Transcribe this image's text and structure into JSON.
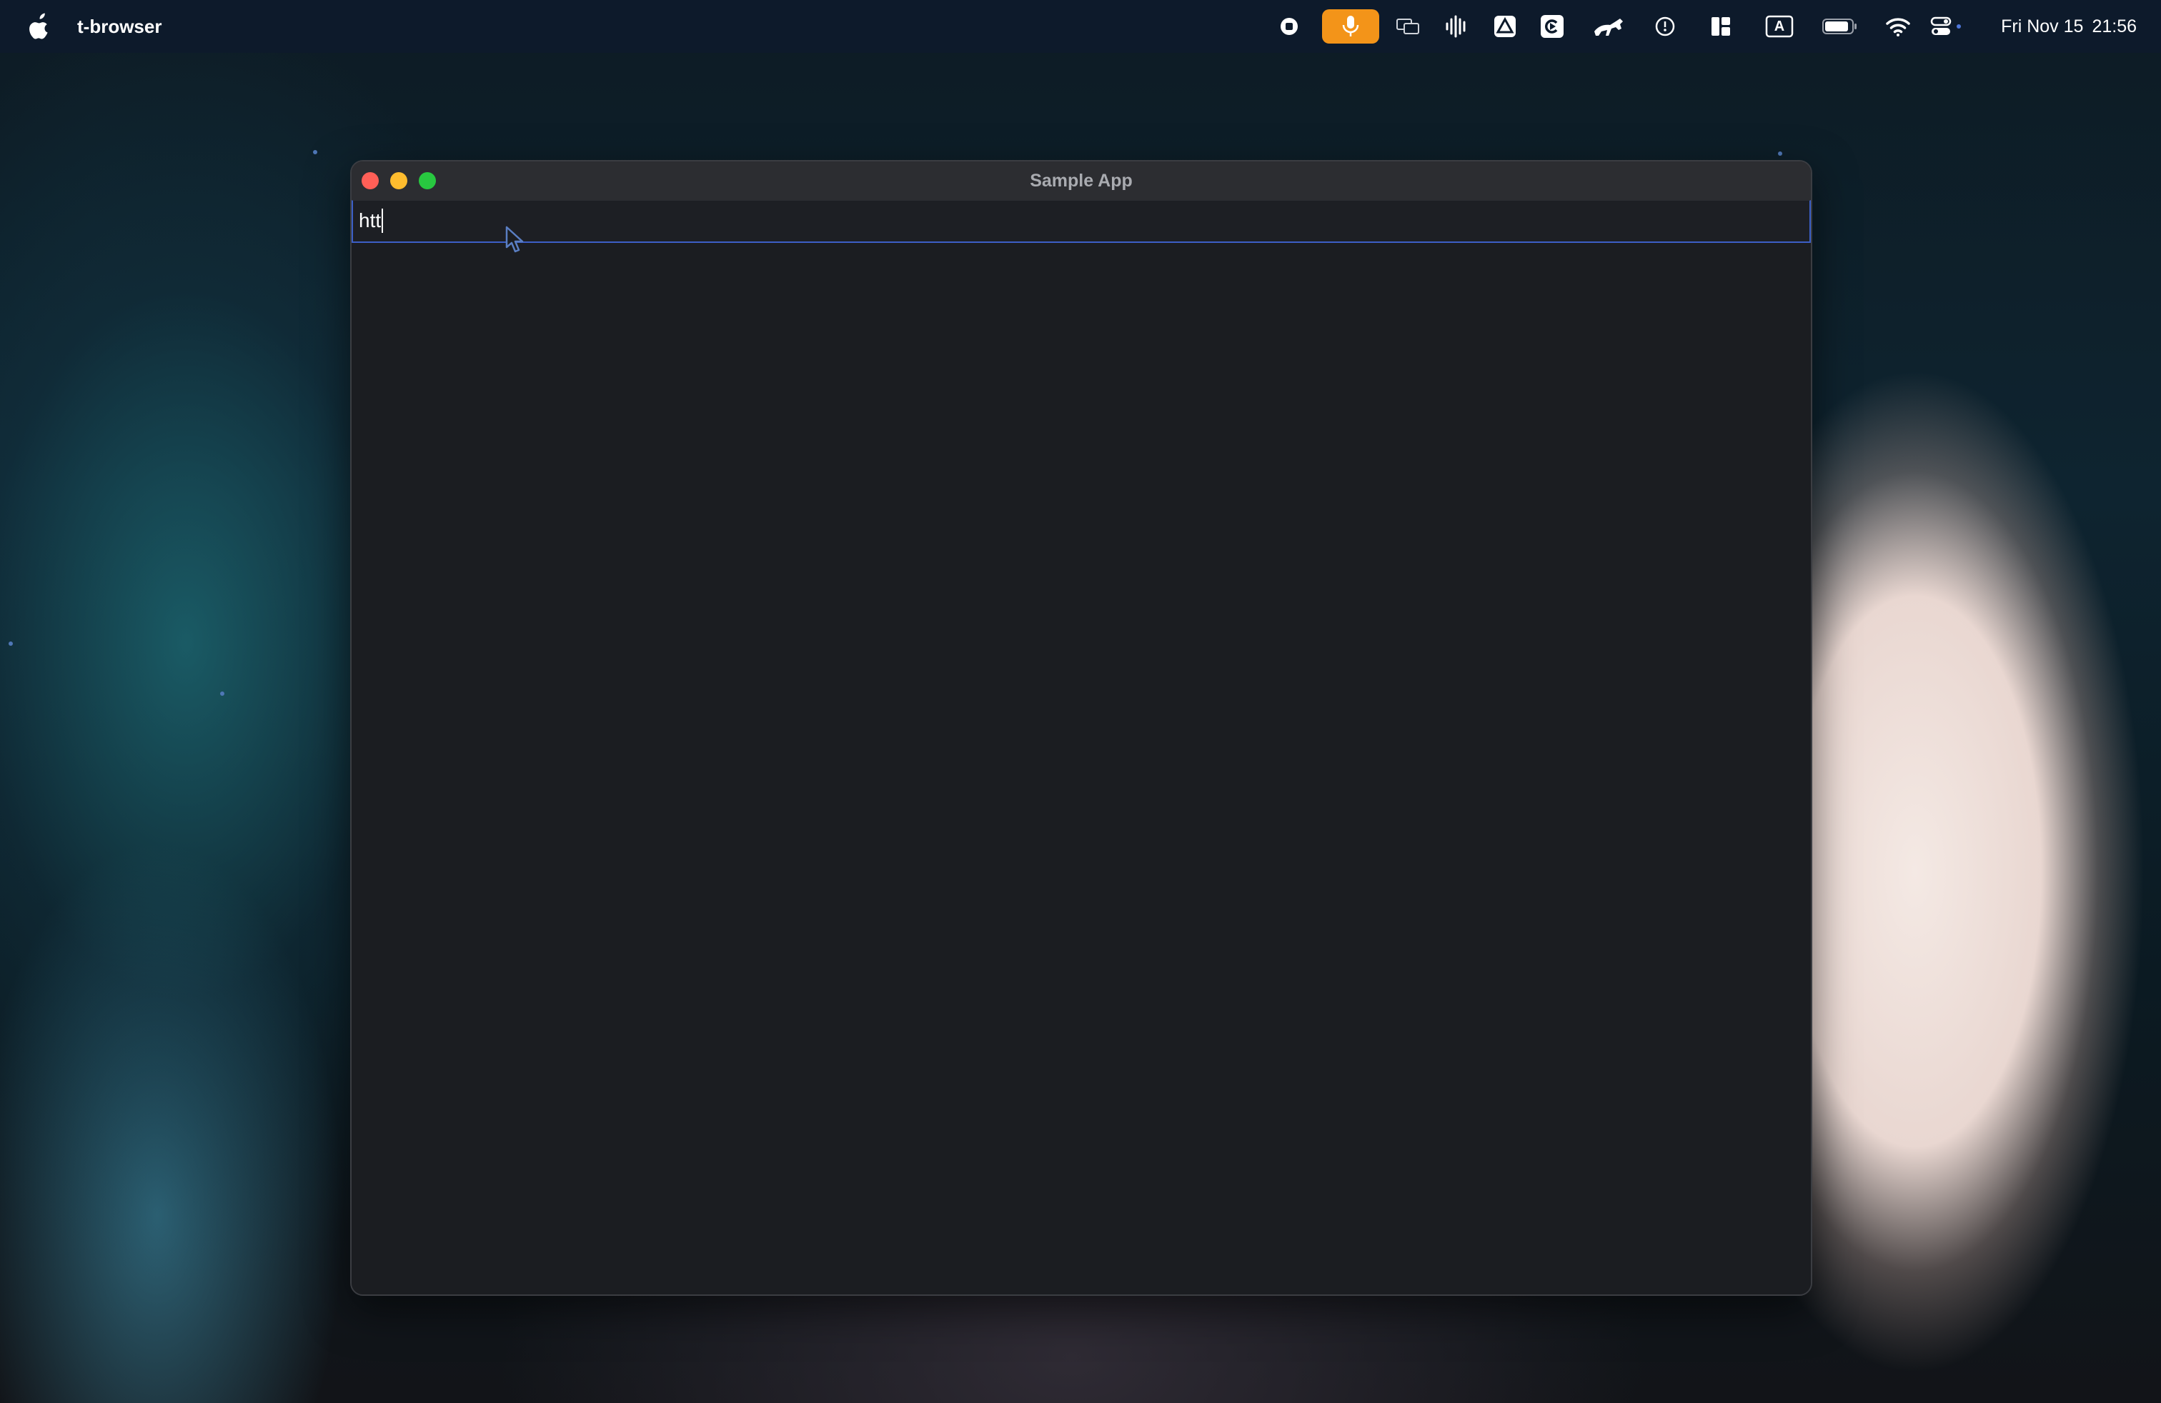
{
  "menubar": {
    "app_name": "t-browser",
    "date": "Fri Nov 15",
    "time": "21:56",
    "icons": [
      "record-stop-icon",
      "microphone-icon",
      "screen-mirroring-icon",
      "audio-waveform-icon",
      "google-drive-icon",
      "screen-recorder-icon",
      "horse-app-icon",
      "time-machine-icon",
      "window-layout-icon",
      "input-source-icon",
      "battery-icon",
      "wifi-icon",
      "control-center-icon"
    ],
    "input_source_label": "A",
    "accent_color": "#f39419"
  },
  "window": {
    "title": "Sample App",
    "url_value": "htt",
    "focus_color": "#3c5fc7"
  }
}
